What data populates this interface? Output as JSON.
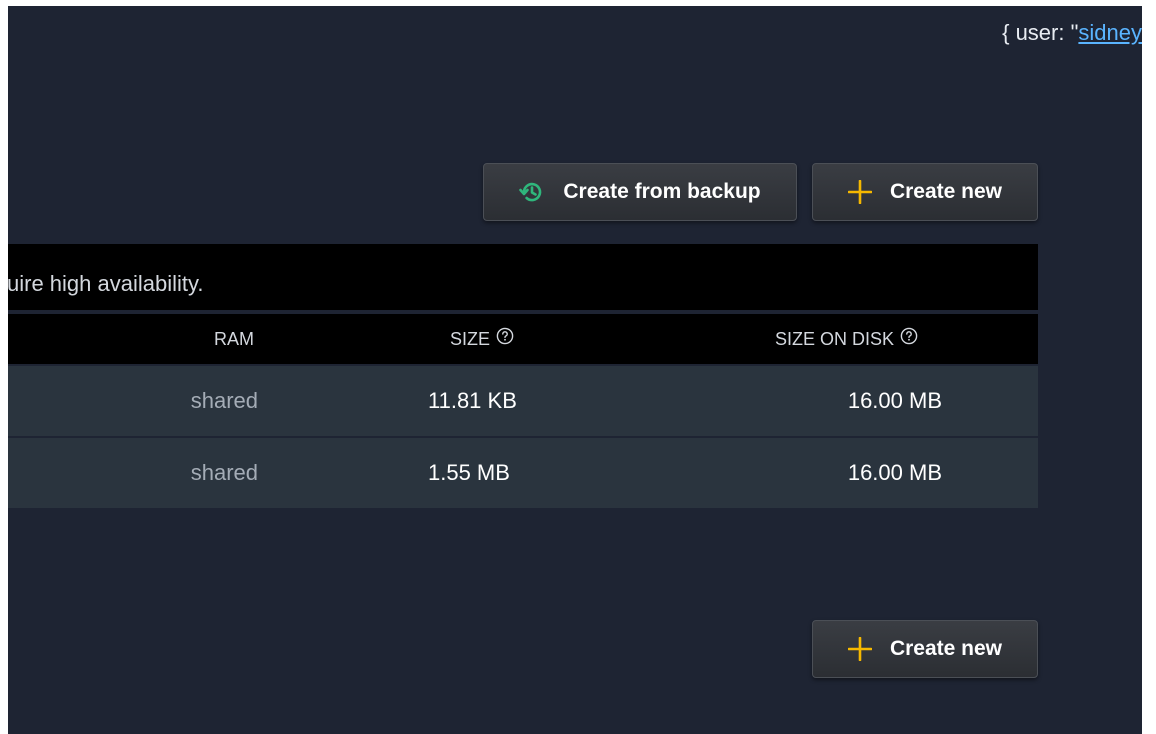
{
  "header": {
    "user_prefix": "{ user: \"",
    "user_link": "sidney"
  },
  "toolbar": {
    "backup_label": "Create from backup",
    "new_label": "Create new",
    "backup_icon_color": "#2fb67c",
    "new_icon_color": "#f5b800"
  },
  "notice": {
    "text": "uire high availability."
  },
  "table": {
    "columns": {
      "ram": "RAM",
      "size": "SIZE",
      "size_on_disk": "SIZE ON DISK"
    },
    "rows": [
      {
        "ram": "shared",
        "size": "11.81 KB",
        "size_on_disk": "16.00 MB"
      },
      {
        "ram": "shared",
        "size": "1.55 MB",
        "size_on_disk": "16.00 MB"
      }
    ]
  },
  "footer": {
    "new_label": "Create new"
  }
}
